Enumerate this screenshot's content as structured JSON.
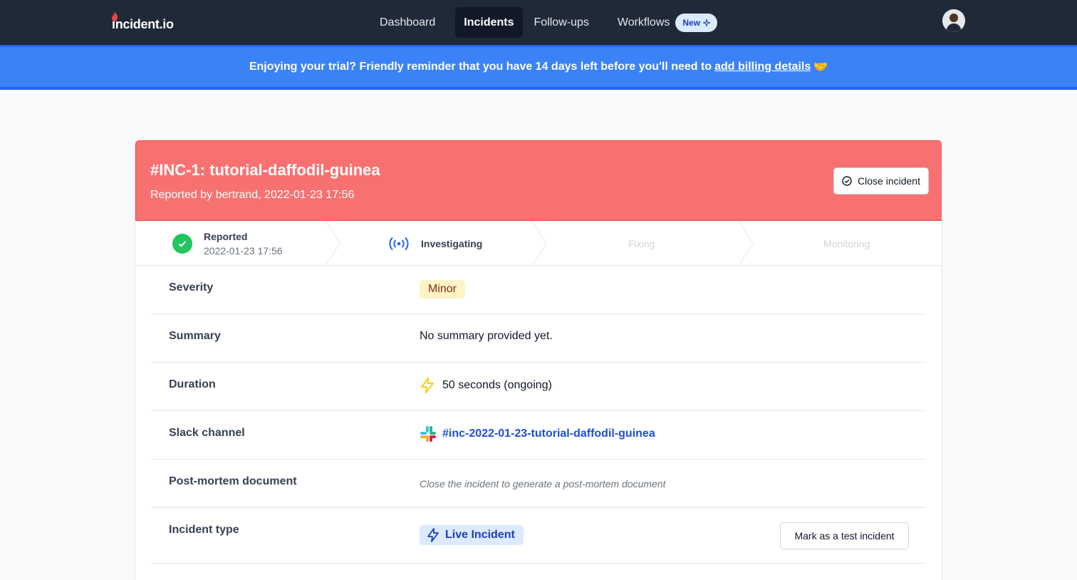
{
  "brand": {
    "name": "incident.io",
    "accent": "#ef4444"
  },
  "nav": {
    "items": [
      {
        "label": "Dashboard",
        "active": false
      },
      {
        "label": "Incidents",
        "active": true
      },
      {
        "label": "Follow-ups",
        "active": false
      },
      {
        "label": "Workflows",
        "active": false,
        "badge": "New"
      }
    ]
  },
  "banner": {
    "text": "Enjoying your trial? Friendly reminder that you have 14 days left before you'll need to",
    "link_text": "add billing details",
    "emoji": "🤝"
  },
  "incident": {
    "title": "#INC-1: tutorial-daffodil-guinea",
    "subtitle": "Reported by bertrand, 2022-01-23 17:56",
    "close_button": "Close incident",
    "header_color": "#f87171",
    "steps": [
      {
        "label": "Reported",
        "date": "2022-01-23 17:56",
        "state": "done"
      },
      {
        "label": "Investigating",
        "state": "current"
      },
      {
        "label": "Fixing",
        "state": "upcoming"
      },
      {
        "label": "Monitoring",
        "state": "upcoming"
      }
    ],
    "details": {
      "severity": {
        "label": "Severity",
        "value": "Minor"
      },
      "summary": {
        "label": "Summary",
        "value": "No summary provided yet."
      },
      "duration": {
        "label": "Duration",
        "value": "50 seconds (ongoing)",
        "icon": "lightning-icon"
      },
      "slack": {
        "label": "Slack channel",
        "value": "#inc-2022-01-23-tutorial-daffodil-guinea",
        "icon": "slack-icon"
      },
      "postmortem": {
        "label": "Post-mortem document",
        "value": "Close the incident to generate a post-mortem document"
      },
      "type": {
        "label": "Incident type",
        "value": "Live Incident",
        "button": "Mark as a test incident"
      }
    }
  }
}
